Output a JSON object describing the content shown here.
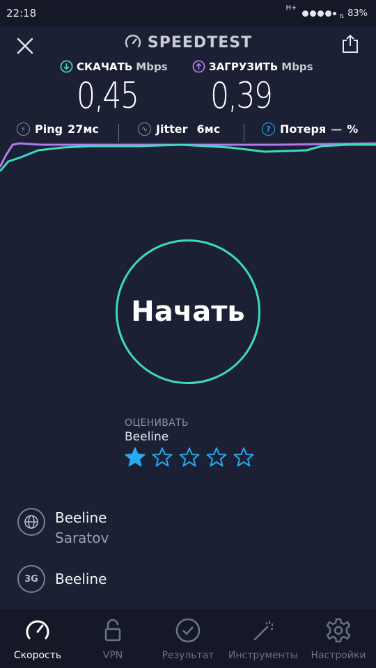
{
  "status_bar": {
    "time": "22:18",
    "network_type": "H+",
    "battery": "83%"
  },
  "header": {
    "title": "SPEEDTEST",
    "close_icon": "close-icon",
    "share_icon": "share-icon"
  },
  "download": {
    "label": "СКАЧАТЬ",
    "unit": "Mbps",
    "value": "0,45"
  },
  "upload": {
    "label": "ЗАГРУЗИТЬ",
    "unit": "Mbps",
    "value": "0,39"
  },
  "metrics": {
    "ping_label": "Ping",
    "ping_value": "27мс",
    "jitter_label": "Jitter",
    "jitter_value": "6мс",
    "loss_label": "Потеря",
    "loss_value": "—",
    "loss_unit": "%"
  },
  "start_button": {
    "label": "Начать"
  },
  "rating": {
    "title": "ОЦЕНИВАТЬ",
    "provider": "Beeline",
    "stars_total": 5,
    "stars_selected": 1
  },
  "isp": {
    "name": "Beeline",
    "location": "Saratov",
    "icon": "globe-icon"
  },
  "network": {
    "badge": "3G",
    "name": "Beeline"
  },
  "bottom_nav": {
    "items": [
      {
        "label": "Скорость",
        "icon": "speedometer-icon",
        "active": true
      },
      {
        "label": "VPN",
        "icon": "lock-icon",
        "active": false
      },
      {
        "label": "Результат",
        "icon": "check-circle-icon",
        "active": false
      },
      {
        "label": "Инструменты",
        "icon": "magic-wand-icon",
        "active": false
      },
      {
        "label": "Настройки",
        "icon": "gear-icon",
        "active": false
      }
    ]
  },
  "colors": {
    "background": "#1b2035",
    "download_accent": "#3dd9c4",
    "upload_accent": "#b07ce8",
    "star_active": "#27a9f5"
  }
}
